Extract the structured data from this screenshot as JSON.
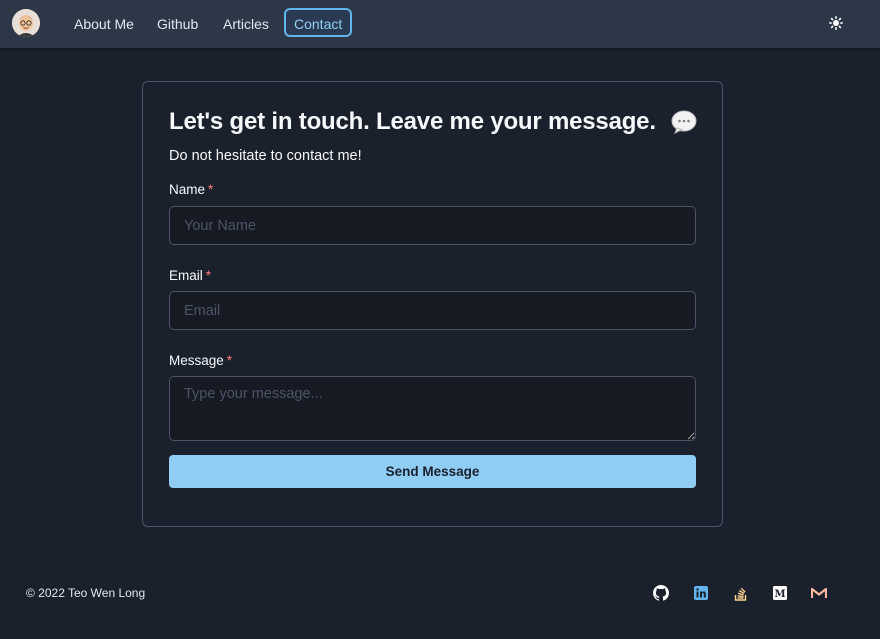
{
  "nav": {
    "links": [
      {
        "label": "About Me"
      },
      {
        "label": "Github"
      },
      {
        "label": "Articles"
      },
      {
        "label": "Contact",
        "active": true
      }
    ],
    "avatar_icon": "avatar-icon",
    "theme_icon": "sun-icon"
  },
  "form": {
    "heading": "Let's get in touch. Leave me your message.",
    "heading_icon": "speech-bubble-icon",
    "subtitle": "Do not hesitate to contact me!",
    "required_marker": "*",
    "name": {
      "label": "Name",
      "placeholder": "Your Name",
      "value": ""
    },
    "email": {
      "label": "Email",
      "placeholder": "Email",
      "value": ""
    },
    "message": {
      "label": "Message",
      "placeholder": "Type your message...",
      "value": ""
    },
    "submit_label": "Send Message"
  },
  "footer": {
    "copyright": "© 2022 Teo Wen Long",
    "socials": [
      "github-icon",
      "linkedin-icon",
      "stackoverflow-icon",
      "medium-icon",
      "gmail-icon"
    ]
  },
  "colors": {
    "background": "#1a202c",
    "navbar": "#2d3748",
    "accent": "#90cdf4",
    "required": "#fc8181"
  }
}
